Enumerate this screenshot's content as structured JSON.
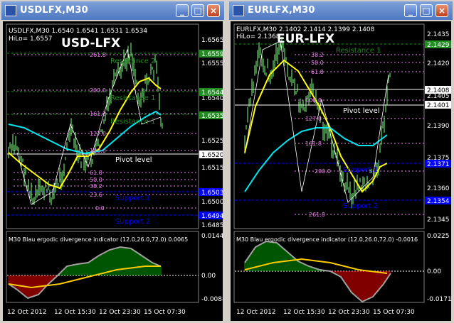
{
  "left_window": {
    "title": "USDLFX,M30",
    "header_line": "USDLFX,M30  1.6540 1.6541 1.6531 1.6534",
    "hilo": "HiLo= 1.6557",
    "big_label": "USD-LFX",
    "price_axis": [
      "1.6565",
      "1.6555",
      "1.6540",
      "1.6525",
      "1.6515",
      "1.6500",
      "1.6485"
    ],
    "price_tags": [
      "1.6559",
      "1.6544",
      "1.6535",
      "1.6520",
      "1.6503",
      "1.6494"
    ],
    "fib_labels": [
      "261.8",
      "200.0",
      "161.8",
      "127.0",
      "100.0",
      "61.8",
      "50.0",
      "38.2",
      "23.6",
      "0.0"
    ],
    "level_labels": {
      "resistance_2": "Resistance 2",
      "resistance_1": "Resistance 1",
      "resistance_0": "Resistance 1",
      "pivot": "Pivot level",
      "support_1": "Support 1",
      "support_2": "Support 2"
    },
    "indicator_title": "M30 Blau ergodic divergence indicator (12.0,26.0,72.0) 0.0065",
    "indicator_axis": [
      "0.0144",
      "0.00",
      "-0.0088"
    ],
    "time_axis": [
      "12 Oct 2012",
      "12 Oct 15:30",
      "12 Oct 23:30",
      "15 Oct 07:30"
    ]
  },
  "right_window": {
    "title": "EURLFX,M30",
    "header_line": "EURLFX,M30  2.1402 2.1414 2.1399 2.1408",
    "hilo": "HiLo= 2.1368",
    "big_label": "EUR-LFX",
    "price_axis": [
      "2.1435",
      "2.1420",
      "2.1405",
      "2.1390",
      "2.1375",
      "2.1360",
      "2.1345"
    ],
    "price_tags": [
      "2.1429",
      "2.1408",
      "2.1401",
      "2.1371",
      "2.1354"
    ],
    "fib_labels": [
      "38.2",
      "50.0",
      "61.8",
      "100.0",
      "127.0",
      "161.8",
      "200.0",
      "261.8"
    ],
    "level_labels": {
      "resistance_1": "Resistance 1",
      "pivot": "Pivot level",
      "support_1": "Support 1",
      "support_2": "Support 2"
    },
    "indicator_title": "M30 Blau ergodic divergence indicator (12.0,26.0,72.0) -0.0016",
    "indicator_axis": [
      "0.0225",
      "0.00",
      "-0.0171"
    ],
    "time_axis": [
      "12 Oct 2012",
      "12 Oct 15:30",
      "12 Oct 23:30",
      "15 Oct 07:30"
    ]
  },
  "window_buttons": {
    "minimize": "_",
    "maximize": "□",
    "close": "×"
  },
  "colors": {
    "background": "#000000",
    "candles": "#7fff7f",
    "yellow_ma": "#ffff00",
    "cyan_ma": "#00e5ee",
    "fib": "#ee82ee",
    "resistance": "#228b22",
    "support": "#0000ff",
    "pivot": "#ffffff",
    "hist_pos": "#00aa00",
    "hist_neg": "#ff0000",
    "signal": "#ffcc00",
    "ergodic": "#a0a0a0"
  }
}
